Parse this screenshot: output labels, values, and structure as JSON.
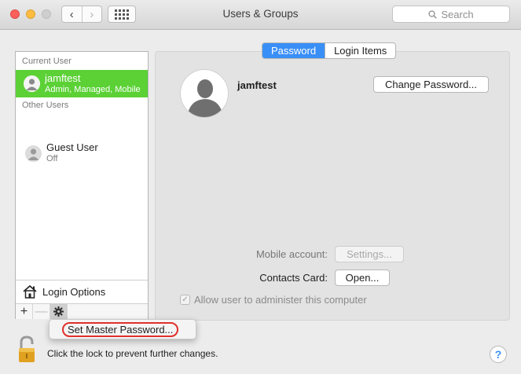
{
  "window": {
    "title": "Users & Groups"
  },
  "search": {
    "placeholder": "Search"
  },
  "sidebar": {
    "current_user_header": "Current User",
    "current_user": {
      "name": "jamftest",
      "subtitle": "Admin, Managed, Mobile"
    },
    "other_users_header": "Other Users",
    "other_users": [
      {
        "name": "Guest User",
        "subtitle": "Off"
      }
    ],
    "login_options_label": "Login Options",
    "add_label": "+",
    "remove_label": "—"
  },
  "popup_menu": {
    "items": [
      "Set Master Password..."
    ]
  },
  "tabs": [
    {
      "label": "Password",
      "active": true
    },
    {
      "label": "Login Items",
      "active": false
    }
  ],
  "main": {
    "user_name": "jamftest",
    "change_password_label": "Change Password...",
    "mobile_account_label": "Mobile account:",
    "settings_label": "Settings...",
    "contacts_card_label": "Contacts Card:",
    "open_label": "Open...",
    "admin_checkbox_label": "Allow user to administer this computer",
    "admin_checked": true
  },
  "footer": {
    "lock_text": "Click the lock to prevent further changes.",
    "help_label": "?"
  },
  "colors": {
    "selection": "#5bd136",
    "accent": "#3a8ff7",
    "highlight_ring": "#e0302b"
  }
}
